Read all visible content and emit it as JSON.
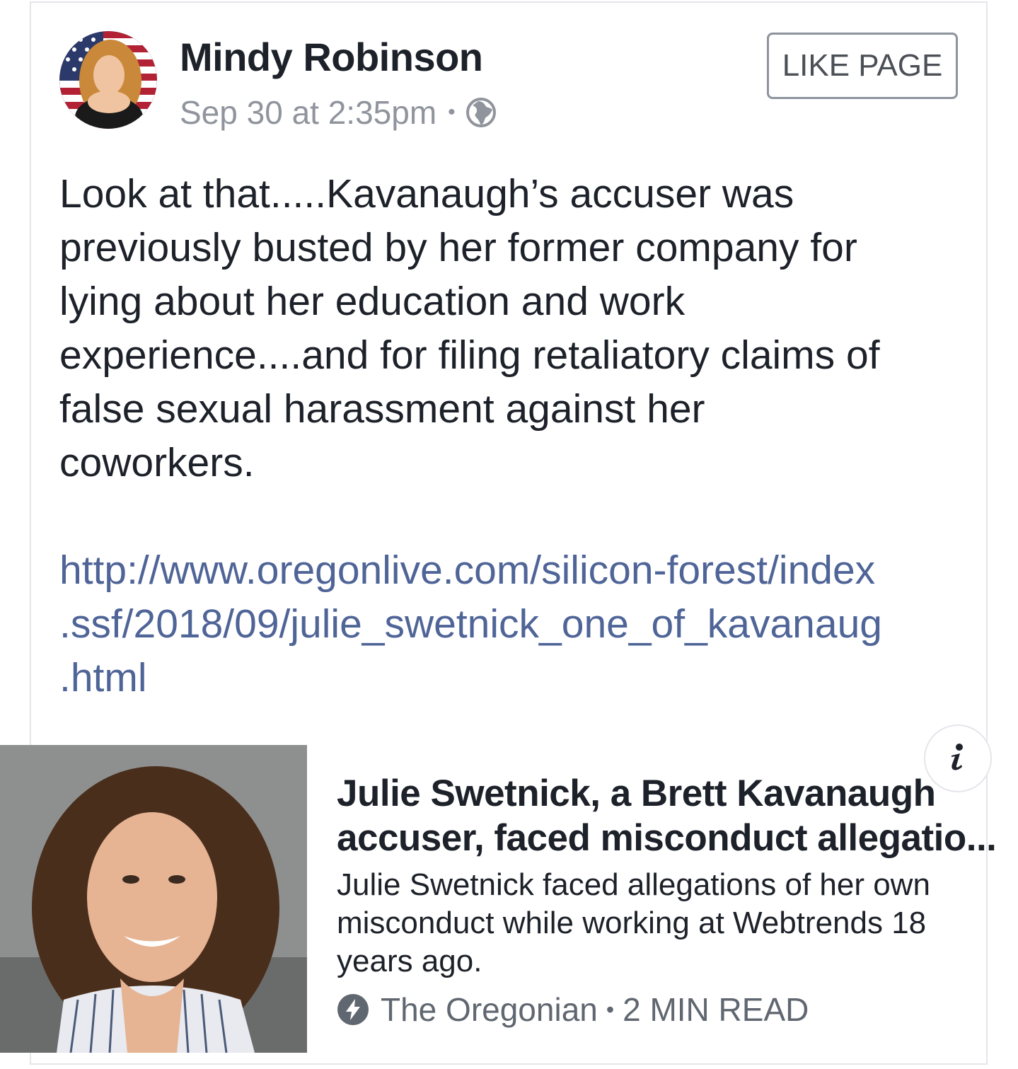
{
  "post": {
    "author": "Mindy Robinson",
    "timestamp": "Sep 30 at 2:35pm",
    "separator": "•",
    "privacy_icon": "globe-icon",
    "like_page_label": "LIKE PAGE",
    "text_lines": [
      "Look at that.....Kavanaugh’s accuser was",
      "previously busted by her former company for",
      "lying about her education and work",
      "experience....and for filing retaliatory claims of",
      "false sexual harassment against her",
      "coworkers."
    ],
    "link_lines": [
      "http://www.oregonlive.com/silicon-forest/index",
      ".ssf/2018/09/julie_swetnick_one_of_kavanaug",
      ".html"
    ]
  },
  "link_preview": {
    "title_lines": [
      "Julie Swetnick, a Brett Kavanaugh",
      "accuser, faced misconduct allegatio..."
    ],
    "description_lines": [
      "Julie Swetnick faced allegations of her own",
      "misconduct while working at Webtrends 18",
      "years ago."
    ],
    "source": "The Oregonian",
    "separator": "•",
    "read_time": "2 MIN READ",
    "info_icon": "info-icon",
    "source_icon": "lightning-bolt-icon"
  },
  "colors": {
    "text": "#1d2129",
    "meta": "#90949c",
    "link": "#4f6497",
    "border": "#e4e6eb",
    "button_border": "#8d949e"
  }
}
